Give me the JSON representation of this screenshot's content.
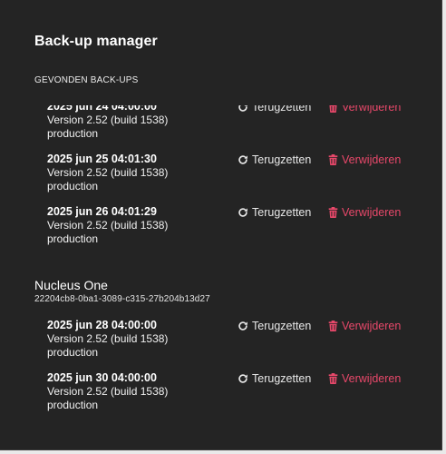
{
  "manager": {
    "title": "Back-up manager",
    "section_label": "GEVONDEN BACK-UPS"
  },
  "actions": {
    "restore_label": "Terugzetten",
    "delete_label": "Verwijderen"
  },
  "colors": {
    "background": "#242424",
    "delete_accent": "#e8486a",
    "text": "#f0f0f0"
  },
  "icons": {
    "restore": "restore-icon",
    "delete": "trash-icon"
  },
  "groups": [
    {
      "title": "",
      "id": "",
      "backups": [
        {
          "date": "2025 jun 24 04:00:00",
          "version": "Version 2.52 (build 1538)",
          "environment": "production"
        },
        {
          "date": "2025 jun 25 04:01:30",
          "version": "Version 2.52 (build 1538)",
          "environment": "production"
        },
        {
          "date": "2025 jun 26 04:01:29",
          "version": "Version 2.52 (build 1538)",
          "environment": "production"
        }
      ]
    },
    {
      "title": "Nucleus One",
      "id": "22204cb8-0ba1-3089-c315-27b204b13d27",
      "backups": [
        {
          "date": "2025 jun 28 04:00:00",
          "version": "Version 2.52 (build 1538)",
          "environment": "production"
        },
        {
          "date": "2025 jun 30 04:00:00",
          "version": "Version 2.52 (build 1538)",
          "environment": "production"
        }
      ]
    }
  ]
}
